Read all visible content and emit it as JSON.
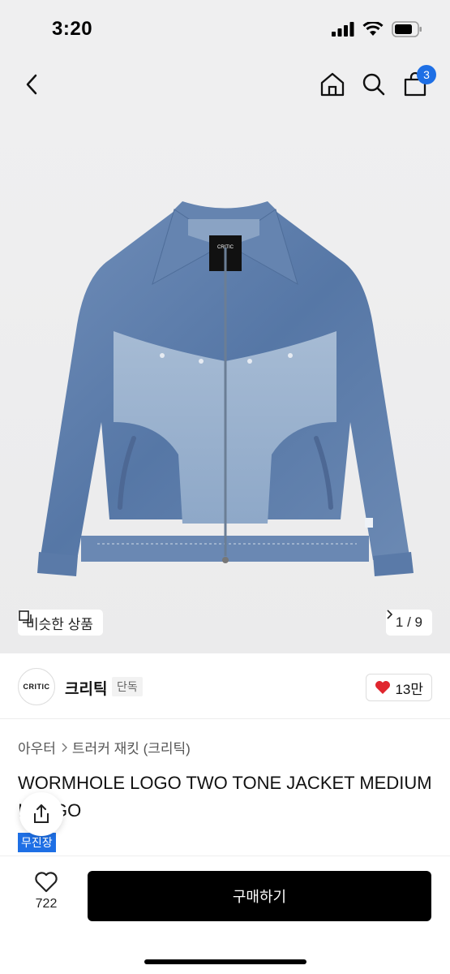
{
  "status": {
    "time": "3:20"
  },
  "nav": {
    "cart_count": "3"
  },
  "hero": {
    "similar_label": "비슷한 상품",
    "counter": "1 / 9",
    "label_brand": "CRITIC"
  },
  "brand": {
    "logo_text": "CRITIC",
    "name": "크리틱",
    "tag": "단독",
    "likes": "13만"
  },
  "breadcrumb": {
    "cat1": "아우터",
    "cat2": "트러커 재킷 (크리틱)"
  },
  "product": {
    "title": "WORMHOLE LOGO TWO TONE JACKET MEDIUM INDIGO",
    "store_tag": "무진장"
  },
  "bottom": {
    "wish_count": "722",
    "buy_label": "구매하기"
  },
  "colors": {
    "accent": "#1e6fe5",
    "heart": "#e0262e",
    "denim_dark": "#5a7cab",
    "denim_light": "#8fa9c9"
  }
}
